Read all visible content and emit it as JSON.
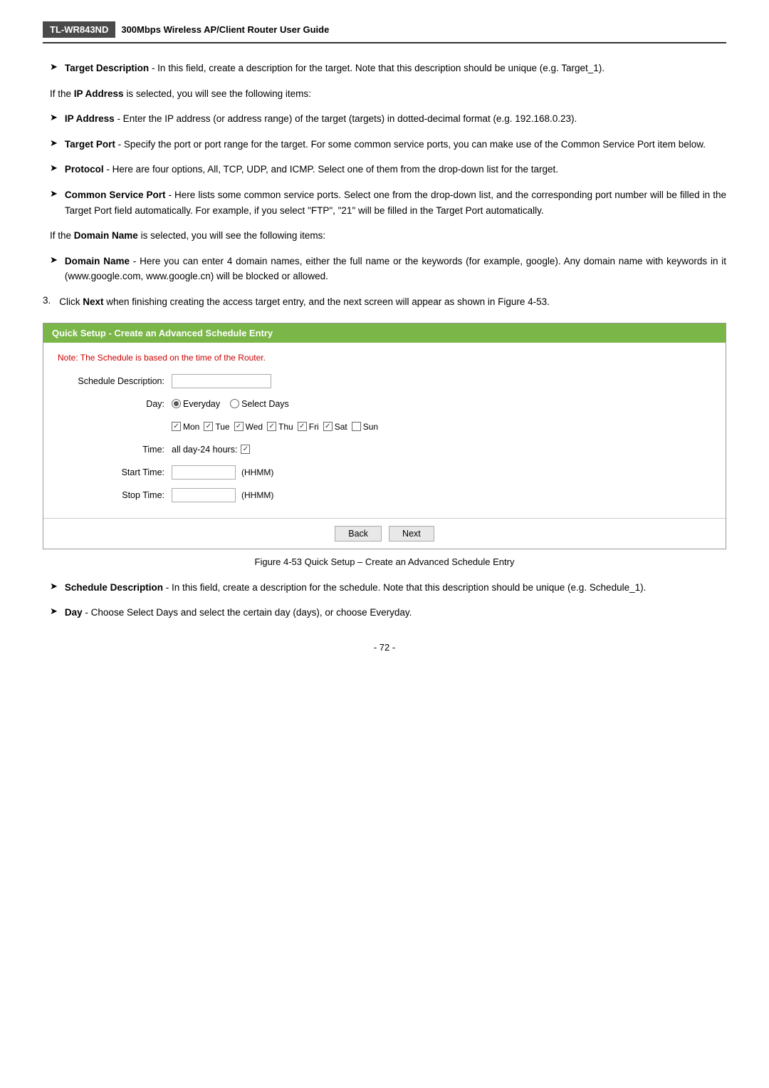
{
  "header": {
    "model": "TL-WR843ND",
    "title": "300Mbps Wireless AP/Client Router User Guide"
  },
  "bullets_section1": [
    {
      "id": "target-desc",
      "bold": "Target Description",
      "text": " - In this field, create a description for the target. Note that this description should be unique (e.g. Target_1)."
    }
  ],
  "plain1": "If the <b>IP Address</b> is selected, you will see the following items:",
  "bullets_section2": [
    {
      "id": "ip-address",
      "bold": "IP Address",
      "text": " - Enter the IP address (or address range) of the target (targets) in dotted-decimal format (e.g. 192.168.0.23)."
    },
    {
      "id": "target-port",
      "bold": "Target Port",
      "text": " - Specify the port or port range for the target. For some common service ports, you can make use of the Common Service Port item below."
    },
    {
      "id": "protocol",
      "bold": "Protocol",
      "text": " - Here are four options, All, TCP, UDP, and ICMP. Select one of them from the drop-down list for the target."
    },
    {
      "id": "common-service-port",
      "bold": "Common Service Port",
      "text": " - Here lists some common service ports. Select one from the drop-down list, and the corresponding port number will be filled in the Target Port field automatically. For example, if you select \"FTP\", \"21\" will be filled in the Target Port automatically."
    }
  ],
  "plain2": "If the <b>Domain Name</b> is selected, you will see the following items:",
  "bullets_section3": [
    {
      "id": "domain-name",
      "bold": "Domain Name",
      "text": " - Here you can enter 4 domain names, either the full name or the keywords (for example, google). Any domain name with keywords in it (www.google.com, www.google.cn) will be blocked or allowed."
    }
  ],
  "numbered_items": [
    {
      "num": "3.",
      "text": "Click <b>Next</b> when finishing creating the access target entry, and the next screen will appear as shown in Figure 4-53."
    }
  ],
  "schedule_box": {
    "header": "Quick Setup - Create an Advanced Schedule Entry",
    "note": "Note: The Schedule is based on the time of the Router.",
    "fields": {
      "schedule_description_label": "Schedule Description:",
      "day_label": "Day:",
      "everyday_label": "Everyday",
      "select_days_label": "Select Days",
      "days": [
        "Mon",
        "Tue",
        "Wed",
        "Thu",
        "Fri",
        "Sat",
        "Sun"
      ],
      "days_checked": [
        true,
        true,
        true,
        true,
        true,
        true,
        false
      ],
      "time_label": "Time:",
      "all_day_label": "all day-24 hours:",
      "all_day_checked": true,
      "start_time_label": "Start Time:",
      "start_time_hint": "(HHMM)",
      "stop_time_label": "Stop Time:",
      "stop_time_hint": "(HHMM)"
    },
    "buttons": {
      "back": "Back",
      "next": "Next"
    }
  },
  "figure_caption": "Figure 4-53   Quick Setup – Create an Advanced Schedule Entry",
  "bullets_section4": [
    {
      "id": "schedule-description",
      "bold": "Schedule Description",
      "text": " - In this field, create a description for the schedule. Note that this description should be unique (e.g. Schedule_1)."
    },
    {
      "id": "day",
      "bold": "Day",
      "text": " - Choose Select Days and select the certain day (days), or choose Everyday."
    }
  ],
  "page_number": "- 72 -"
}
